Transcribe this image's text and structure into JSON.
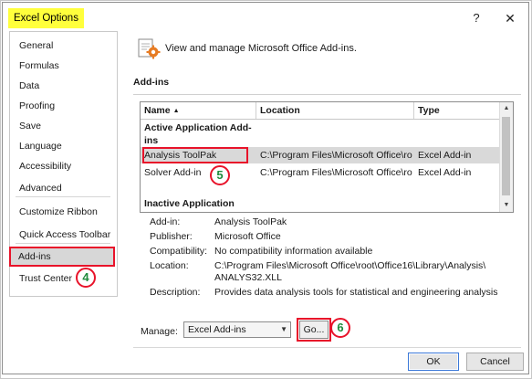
{
  "window": {
    "title": "Excel Options",
    "help_glyph": "?",
    "close_glyph": "✕"
  },
  "nav": {
    "items": [
      "General",
      "Formulas",
      "Data",
      "Proofing",
      "Save",
      "Language",
      "Accessibility",
      "Advanced",
      "Customize Ribbon",
      "Quick Access Toolbar",
      "Add-ins",
      "Trust Center"
    ],
    "selected": "Add-ins"
  },
  "header": {
    "text": "View and manage Microsoft Office Add-ins."
  },
  "section": {
    "title": "Add-ins"
  },
  "grid": {
    "columns": {
      "name": "Name",
      "location": "Location",
      "type": "Type",
      "sort_glyph": "▲"
    },
    "groups": {
      "active": "Active Application Add-ins",
      "inactive": "Inactive Application"
    },
    "rows": [
      {
        "name": "Analysis ToolPak",
        "location": "C:\\Program Files\\Microsoft Office\\ro",
        "type": "Excel Add-in"
      },
      {
        "name": "Solver Add-in",
        "location": "C:\\Program Files\\Microsoft Office\\ro",
        "type": "Excel Add-in"
      }
    ],
    "scroll_up": "▲",
    "scroll_down": "▼"
  },
  "details": {
    "addin_label": "Add-in:",
    "addin_value": "Analysis ToolPak",
    "publisher_label": "Publisher:",
    "publisher_value": "Microsoft Office",
    "compat_label": "Compatibility:",
    "compat_value": "No compatibility information available",
    "location_label": "Location:",
    "location_value_1": "C:\\Program Files\\Microsoft Office\\root\\Office16\\Library\\Analysis\\",
    "location_value_2": "ANALYS32.XLL",
    "description_label": "Description:",
    "description_value": "Provides data analysis tools for statistical and engineering analysis"
  },
  "manage": {
    "label": "Manage:",
    "selected": "Excel Add-ins",
    "caret": "▼",
    "go_label": "Go..."
  },
  "buttons": {
    "ok": "OK",
    "cancel": "Cancel"
  },
  "annotations": {
    "step_4": "4",
    "step_5": "5",
    "step_6": "6"
  },
  "colors": {
    "title_highlight": "#ffff3c",
    "annotation_red": "#e8132a",
    "annotation_green": "#1e8b3c",
    "selection_gray": "#d9d9d9"
  }
}
